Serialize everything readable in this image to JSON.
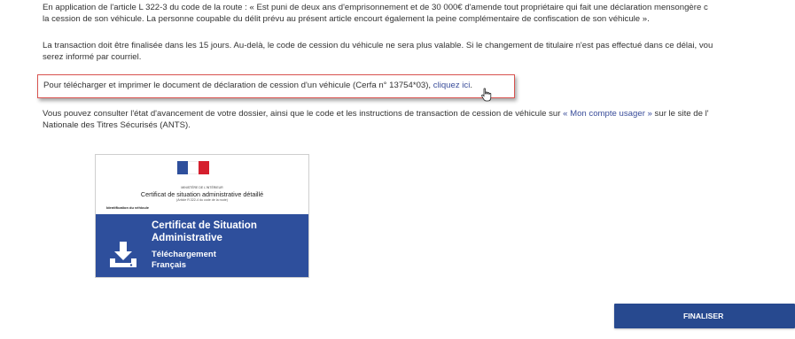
{
  "paragraphs": {
    "p1_line1": "En application de l'article L 322-3 du code de la route : « Est puni de deux ans d'emprisonnement et de 30 000€ d'amende tout propriétaire qui fait une déclaration mensongère c",
    "p1_line2": "la cession de son véhicule. La personne coupable du délit prévu au présent article encourt également la peine complémentaire de confiscation de son véhicule ».",
    "p2_line1": "La transaction doit être finalisée dans les 15 jours. Au-delà, le code de cession du véhicule ne sera plus valable. Si le changement de titulaire n'est pas effectué dans ce délai, vou",
    "p2_line2": "serez informé par courriel.",
    "p4_line1_pre": "Vous pouvez consulter l'état d'avancement de votre dossier, ainsi que le code et les instructions de transaction de cession de véhicule sur ",
    "p4_link": "« Mon compte usager »",
    "p4_line1_post": " sur le site de l'",
    "p4_line2": "Nationale des Titres Sécurisés (ANTS)."
  },
  "highlight": {
    "text": "Pour télécharger et imprimer le document de déclaration de cession d'un véhicule (Cerfa n° 13754*03), ",
    "link": "cliquez ici",
    "after": "."
  },
  "card": {
    "ministere": "MINISTÈRE DE L'INTÉRIEUR",
    "doc_title": "Certificat de situation administrative détaillé",
    "doc_subtitle": "(Article R.322-4 du code de la route)",
    "ident": "Identification du véhicule",
    "banner_title_line1": "Certificat de Situation",
    "banner_title_line2": "Administrative",
    "download_line1": "Téléchargement",
    "download_line2": "Français"
  },
  "finalize_button": "FINALISER",
  "colors": {
    "link": "#3a4d9a",
    "banner": "#2e4f9c",
    "button": "#27498f",
    "highlight_border": "#d9534f"
  }
}
